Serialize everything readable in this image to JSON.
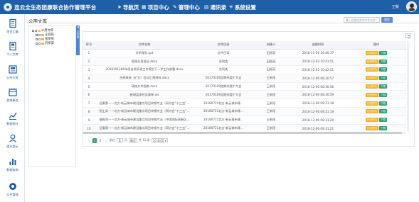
{
  "header": {
    "app_title": "连云全生态团康联合协作管理平台",
    "nav": [
      {
        "label": "导航页",
        "icon": "send-icon"
      },
      {
        "label": "项目中心",
        "icon": "grid-icon"
      },
      {
        "label": "管理中心",
        "icon": "wrench-icon"
      },
      {
        "label": "通讯录",
        "icon": "contacts-icon"
      },
      {
        "label": "系统设置",
        "icon": "gear-icon"
      }
    ],
    "user_name": "王新"
  },
  "sidebar": {
    "items": [
      {
        "label": "项目汇编",
        "icon": "document-icon"
      },
      {
        "label": "个人文库",
        "icon": "book-icon"
      },
      {
        "label": "公共文库",
        "icon": "library-icon"
      },
      {
        "label": "营销事务",
        "icon": "calendar-icon"
      },
      {
        "label": "数据统计",
        "icon": "chart-icon"
      },
      {
        "label": "通讯提示",
        "icon": "person-icon"
      },
      {
        "label": "数据查询",
        "icon": "bar-chart-icon"
      },
      {
        "label": "公共管理",
        "icon": "manage-icon"
      }
    ]
  },
  "page": {
    "title": "公用文库",
    "search_placeholder": "输入您要搜索的文件名称",
    "search_button": "搜索"
  },
  "tree": {
    "root": "公用文库",
    "children": [
      "王铁铁",
      "张梁莱",
      "刘梁菜"
    ]
  },
  "splitter": {
    "label": "文件夹"
  },
  "table": {
    "columns": [
      "序号",
      "文件名称",
      "文件目录",
      "创建人",
      "创建时间",
      "操作"
    ],
    "view_label": "在线预览",
    "download_label": "下载",
    "rows": [
      {
        "no": "1",
        "name": "学术规则.ppt",
        "dir": "文件目录",
        "creator": "田银英",
        "time": "2018-11-26 16:46:37"
      },
      {
        "no": "2",
        "name": "规则分发部分.docx",
        "dir": "合同类",
        "creator": "田银英",
        "time": "2018-12-03 10:41:51"
      },
      {
        "no": "3",
        "name": "2018101286年度自然资源工作规划下一步工作部署.docx",
        "dir": "合同类",
        "creator": "田银英",
        "time": "2018-12-03 10:42:51"
      },
      {
        "no": "4",
        "name": "合规审核（扩大）会议汇报材料.docx",
        "dir": "20170109定期季度扩大会",
        "creator": "王新阳",
        "time": "2018-12-06 08:30:57"
      },
      {
        "no": "5",
        "name": "请按文件指南.docx",
        "dir": "20170109定期季度扩大会",
        "creator": "王新阳",
        "time": "2018-12-06 08:30:58"
      },
      {
        "no": "6",
        "name": "新增监测任务清单.xls",
        "dir": "20170109定期季度扩大会",
        "creator": "王新阳",
        "time": "2018-12-06 08:30:59"
      },
      {
        "no": "7",
        "name": "征集第一一北方·新云城市建设重点项目申报专业（研讨会“十三五”...",
        "dir": "20180721北方·新云城市建...",
        "creator": "王新阳",
        "time": "2018-12-06 08:31:18"
      },
      {
        "no": "8",
        "name": "国土局——北方·新云城市建设重点项目申报专业（研讨会“十三五”...",
        "dir": "20180721北方·新云城市建...",
        "creator": "王新阳",
        "time": "2018-12-06 08:31:19"
      },
      {
        "no": "9",
        "name": "情报资——北方·新云城市建设重点项目申报专业（中国国际高新区...",
        "dir": "20180721北方·新云城市建...",
        "creator": "王新阳",
        "time": "2018-12-06 08:31:20"
      },
      {
        "no": "10",
        "name": "征集第一一北方·新云城市建设重点项目申报专业（研讨会“十三五”...",
        "dir": "20180721北方·新云城市建...",
        "creator": "王新阳",
        "time": "2018-12-06 08:31:21"
      }
    ]
  },
  "pager": {
    "prev": "‹",
    "pages": [
      "1",
      "2"
    ],
    "next": "›",
    "goto_label": "前往",
    "current_input": "1",
    "page_unit": "页",
    "confirm": "确定",
    "total": "共 12 条",
    "size": "10 条/页"
  },
  "colors": {
    "topbar": "#1f5fa8",
    "accent": "#4c86cf",
    "view_button": "#f0ad1e",
    "download_button": "#2c9d74"
  }
}
